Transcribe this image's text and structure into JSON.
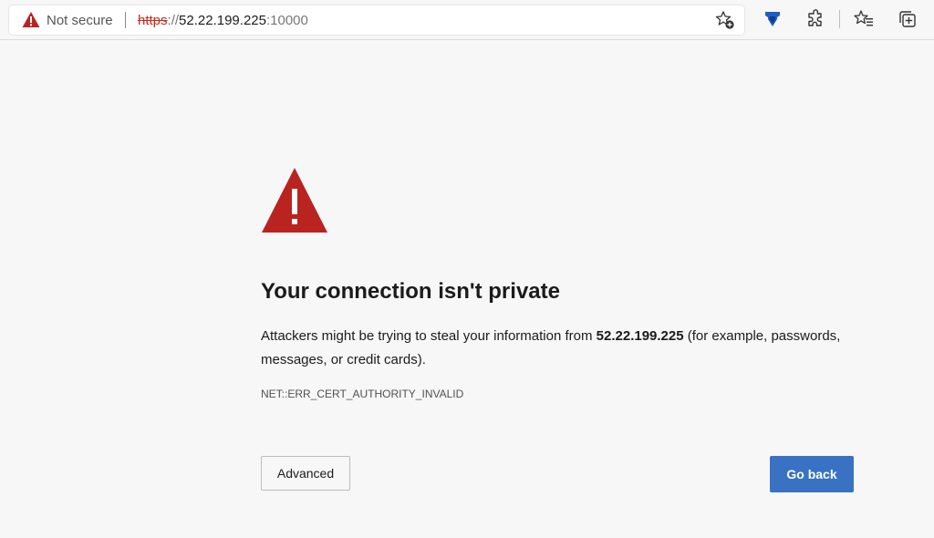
{
  "toolbar": {
    "security_status": "Not secure",
    "url": {
      "scheme": "https",
      "separator": "://",
      "host": "52.22.199.225",
      "port": ":10000"
    },
    "icons": [
      "warning-icon",
      "favorite-add-icon",
      "extension-badge-icon",
      "extensions-icon",
      "favorites-icon",
      "collections-icon"
    ]
  },
  "error_page": {
    "heading": "Your connection isn't private",
    "description_before": "Attackers might be trying to steal your information from ",
    "description_host": "52.22.199.225",
    "description_after": " (for example, passwords, messages, or credit cards).",
    "error_code": "NET::ERR_CERT_AUTHORITY_INVALID",
    "advanced_label": "Advanced",
    "go_back_label": "Go back"
  },
  "colors": {
    "warning": "#b92320",
    "primary_button": "#3a72c3",
    "page_background": "#f7f7f7"
  }
}
